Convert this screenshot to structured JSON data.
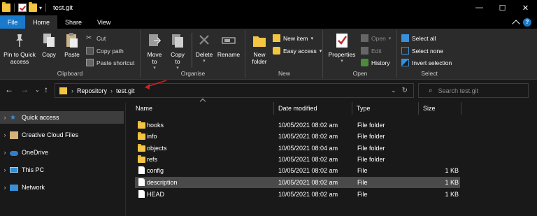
{
  "window": {
    "title": "test.git",
    "controls": [
      "—",
      "☐",
      "✕"
    ]
  },
  "tabs": [
    "File",
    "Home",
    "Share",
    "View"
  ],
  "ribbon": {
    "clipboard": {
      "label": "Clipboard",
      "pin_label": "Pin to Quick access",
      "copy_label": "Copy",
      "paste_label": "Paste",
      "cut_label": "Cut",
      "copy_path_label": "Copy path",
      "paste_shortcut_label": "Paste shortcut"
    },
    "organise": {
      "label": "Organise",
      "move_to_label": "Move to",
      "copy_to_label": "Copy to",
      "delete_label": "Delete",
      "rename_label": "Rename"
    },
    "new": {
      "label": "New",
      "new_folder_label": "New folder",
      "new_item_label": "New item",
      "easy_access_label": "Easy access"
    },
    "open": {
      "label": "Open",
      "properties_label": "Properties",
      "open_label": "Open",
      "edit_label": "Edit",
      "history_label": "History"
    },
    "select": {
      "label": "Select",
      "select_all_label": "Select all",
      "select_none_label": "Select none",
      "invert_selection_label": "Invert selection"
    }
  },
  "address": {
    "crumbs": [
      "Repository",
      "test.git"
    ],
    "search_placeholder": "Search test.git"
  },
  "nav": [
    {
      "label": "Quick access",
      "icon": "star-icon",
      "selected": true
    },
    {
      "label": "Creative Cloud Files",
      "icon": "folder-icon"
    },
    {
      "label": "OneDrive",
      "icon": "cloud-icon"
    },
    {
      "label": "This PC",
      "icon": "computer-icon"
    },
    {
      "label": "Network",
      "icon": "network-icon"
    }
  ],
  "columns": {
    "name": "Name",
    "date": "Date modified",
    "type": "Type",
    "size": "Size"
  },
  "files": [
    {
      "name": "hooks",
      "date": "10/05/2021 08:02 am",
      "type": "File folder",
      "size": "",
      "kind": "folder"
    },
    {
      "name": "info",
      "date": "10/05/2021 08:02 am",
      "type": "File folder",
      "size": "",
      "kind": "folder"
    },
    {
      "name": "objects",
      "date": "10/05/2021 08:04 am",
      "type": "File folder",
      "size": "",
      "kind": "folder"
    },
    {
      "name": "refs",
      "date": "10/05/2021 08:02 am",
      "type": "File folder",
      "size": "",
      "kind": "folder"
    },
    {
      "name": "config",
      "date": "10/05/2021 08:02 am",
      "type": "File",
      "size": "1 KB",
      "kind": "file"
    },
    {
      "name": "description",
      "date": "10/05/2021 08:02 am",
      "type": "File",
      "size": "1 KB",
      "kind": "file",
      "selected": true
    },
    {
      "name": "HEAD",
      "date": "10/05/2021 08:02 am",
      "type": "File",
      "size": "1 KB",
      "kind": "file"
    }
  ],
  "colors": {
    "accent": "#1979ca",
    "folder": "#f4c542",
    "annotation_arrow": "#d42020"
  }
}
